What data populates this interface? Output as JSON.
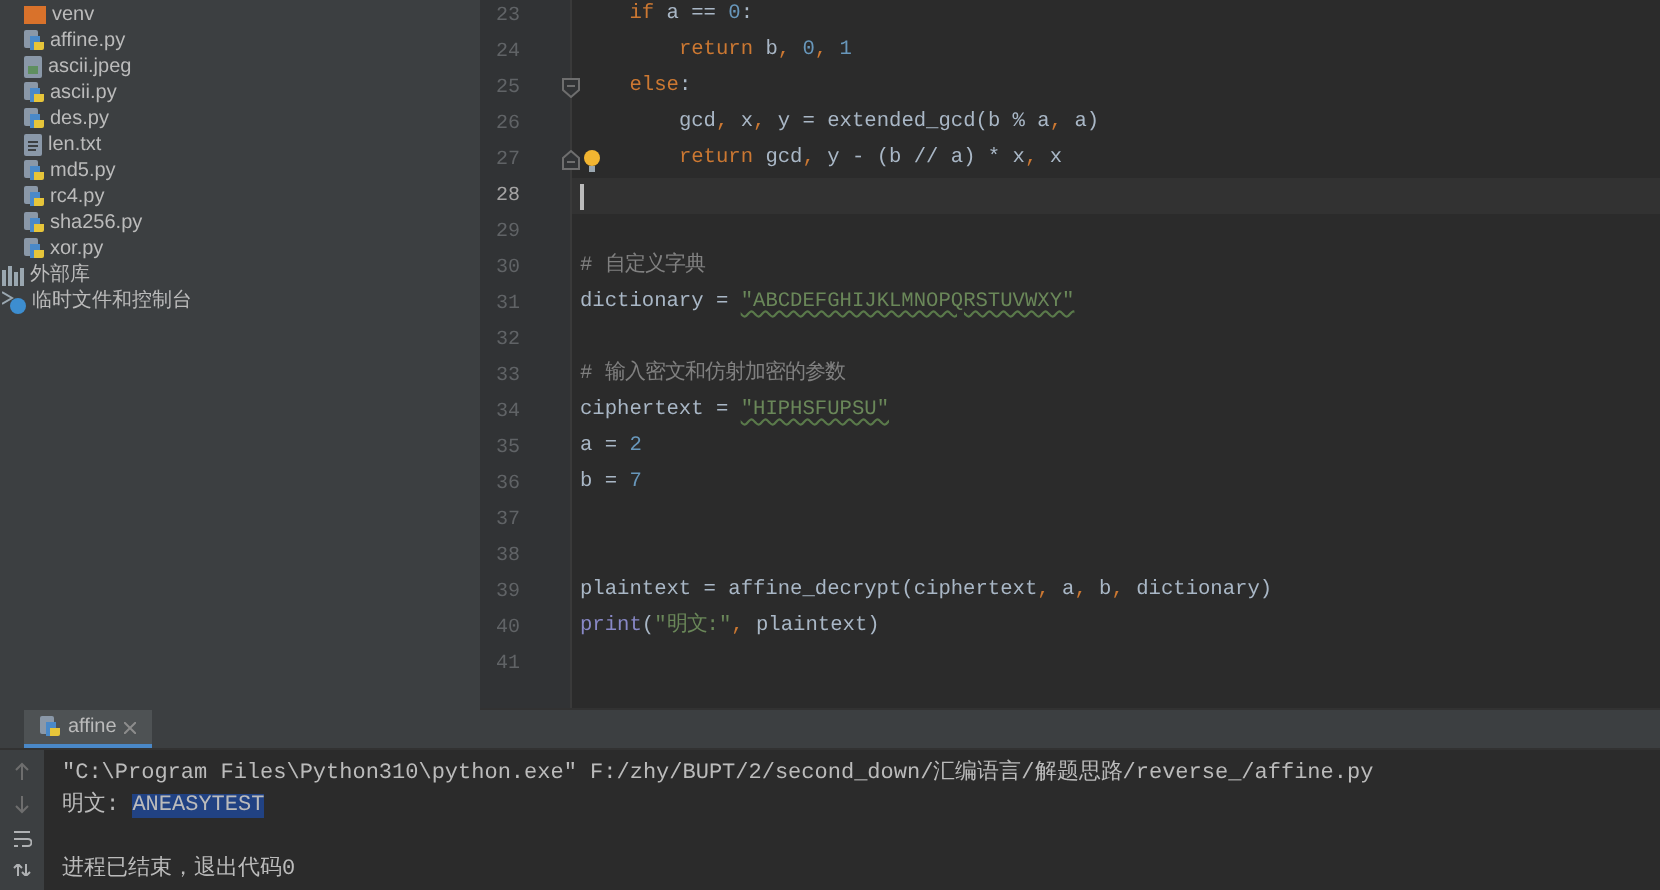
{
  "project_tree": {
    "items": [
      {
        "label": "venv",
        "kind": "folder"
      },
      {
        "label": "affine.py",
        "kind": "python"
      },
      {
        "label": "ascii.jpeg",
        "kind": "image"
      },
      {
        "label": "ascii.py",
        "kind": "python"
      },
      {
        "label": "des.py",
        "kind": "python"
      },
      {
        "label": "len.txt",
        "kind": "text"
      },
      {
        "label": "md5.py",
        "kind": "python"
      },
      {
        "label": "rc4.py",
        "kind": "python"
      },
      {
        "label": "sha256.py",
        "kind": "python"
      },
      {
        "label": "xor.py",
        "kind": "python"
      },
      {
        "label": "外部库",
        "kind": "library"
      },
      {
        "label": "临时文件和控制台",
        "kind": "scratch"
      }
    ]
  },
  "editor": {
    "lines": [
      {
        "number": "23",
        "current": false,
        "tokens": [
          {
            "text": "    if",
            "kind": "keyword"
          },
          {
            "text": " a == "
          },
          {
            "text": "0",
            "kind": "number"
          },
          {
            "text": ":"
          }
        ]
      },
      {
        "number": "24",
        "current": false,
        "tokens": [
          {
            "text": "        return",
            "kind": "keyword"
          },
          {
            "text": " b"
          },
          {
            "text": ",",
            "kind": "keyword"
          },
          {
            "text": " 0",
            "kind": "number"
          },
          {
            "text": ",",
            "kind": "keyword"
          },
          {
            "text": " 1",
            "kind": "number"
          }
        ]
      },
      {
        "number": "25",
        "current": false,
        "tokens": [
          {
            "text": "    else",
            "kind": "keyword"
          },
          {
            "text": ":"
          }
        ]
      },
      {
        "number": "26",
        "current": false,
        "tokens": [
          {
            "text": "        gcd"
          },
          {
            "text": ",",
            "kind": "keyword"
          },
          {
            "text": " x"
          },
          {
            "text": ",",
            "kind": "keyword"
          },
          {
            "text": " y = extended_gcd(b % a"
          },
          {
            "text": ",",
            "kind": "keyword"
          },
          {
            "text": " a)"
          }
        ]
      },
      {
        "number": "27",
        "current": false,
        "tokens": [
          {
            "text": "        return",
            "kind": "keyword"
          },
          {
            "text": " gcd"
          },
          {
            "text": ",",
            "kind": "keyword"
          },
          {
            "text": " y - (b // a) * x"
          },
          {
            "text": ",",
            "kind": "keyword"
          },
          {
            "text": " x"
          }
        ]
      },
      {
        "number": "28",
        "current": true
      },
      {
        "number": "29",
        "current": false
      },
      {
        "number": "30",
        "current": false,
        "tokens": [
          {
            "text": "# 自定义字典",
            "kind": "comment"
          }
        ]
      },
      {
        "number": "31",
        "current": false,
        "tokens": [
          {
            "text": "dictionary = "
          },
          {
            "text": "\"ABCDEFGHIJKLMNOPQRSTUVWXY\"",
            "kind": "string"
          }
        ]
      },
      {
        "number": "32",
        "current": false
      },
      {
        "number": "33",
        "current": false,
        "tokens": [
          {
            "text": "# 输入密文和仿射加密的参数",
            "kind": "comment"
          }
        ]
      },
      {
        "number": "34",
        "current": false,
        "tokens": [
          {
            "text": "ciphertext = "
          },
          {
            "text": "\"HIPHSFUPSU\"",
            "kind": "string"
          }
        ]
      },
      {
        "number": "35",
        "current": false,
        "tokens": [
          {
            "text": "a = "
          },
          {
            "text": "2",
            "kind": "number"
          }
        ]
      },
      {
        "number": "36",
        "current": false,
        "tokens": [
          {
            "text": "b = "
          },
          {
            "text": "7",
            "kind": "number"
          }
        ]
      },
      {
        "number": "37",
        "current": false
      },
      {
        "number": "38",
        "current": false
      },
      {
        "number": "39",
        "current": false,
        "tokens": [
          {
            "text": "plaintext = affine_decrypt(ciphertext"
          },
          {
            "text": ",",
            "kind": "keyword"
          },
          {
            "text": " a"
          },
          {
            "text": ",",
            "kind": "keyword"
          },
          {
            "text": " b"
          },
          {
            "text": ",",
            "kind": "keyword"
          },
          {
            "text": " dictionary)"
          }
        ]
      },
      {
        "number": "40",
        "current": false,
        "tokens": [
          {
            "text": "print",
            "kind": "builtin"
          },
          {
            "text": "("
          },
          {
            "text": "\"明文:\"",
            "kind": "string"
          },
          {
            "text": ",",
            "kind": "keyword"
          },
          {
            "text": " plaintext)"
          }
        ]
      },
      {
        "number": "41",
        "current": false
      }
    ]
  },
  "run_panel": {
    "tab": {
      "label": "affine",
      "selected": true
    },
    "output": [
      {
        "parts": [
          {
            "text": "\"C:\\Program Files\\Python310\\python.exe\" F:/zhy/BUPT/2/second_down/汇编语言/解题思路/reverse_/affine.py"
          }
        ]
      },
      {
        "parts": [
          {
            "text": "明文: "
          },
          {
            "text": "ANEASYTEST",
            "selected": true
          }
        ]
      },
      {
        "kind": "exit",
        "parts": [
          {
            "text": "进程已结束，退出代码0"
          }
        ]
      }
    ]
  }
}
